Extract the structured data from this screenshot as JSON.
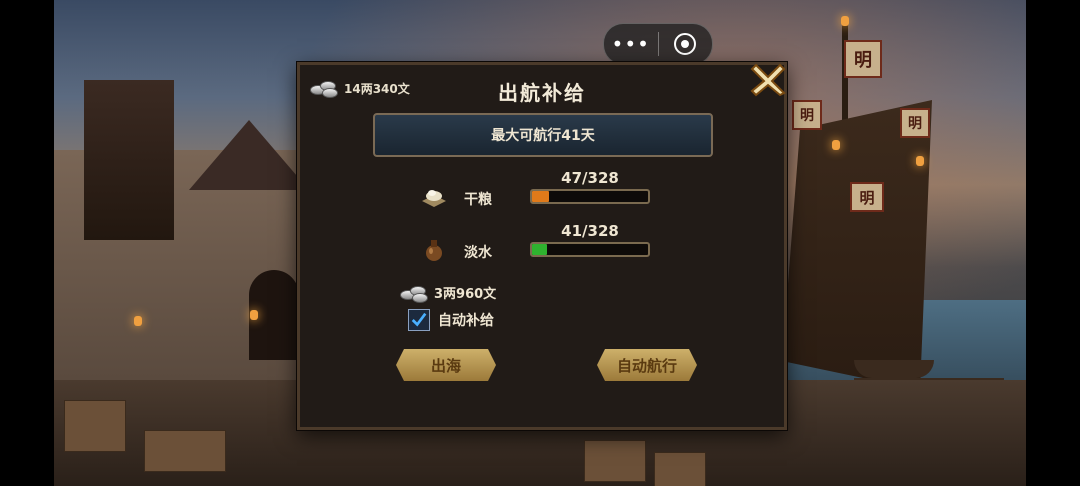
{
  "capsule": {
    "more_icon": "more-dots-icon",
    "close_icon": "target-close-icon"
  },
  "panel": {
    "title": "出航补给",
    "money": "14两340文",
    "info": "最大可航行41天",
    "resources": [
      {
        "label": "干粮",
        "count": "47/328",
        "fill_fraction": 0.143,
        "color": "#e07a1a",
        "icon": "food-icon"
      },
      {
        "label": "淡水",
        "count": "41/328",
        "fill_fraction": 0.125,
        "color": "#2fb22f",
        "icon": "water-gourd-icon"
      }
    ],
    "cost": "3两960文",
    "auto_supply": {
      "label": "自动补给",
      "checked": true
    },
    "buttons": {
      "sail": "出海",
      "auto_sail": "自动航行"
    }
  },
  "background": {
    "flags": [
      "明",
      "明",
      "明",
      "明"
    ]
  }
}
